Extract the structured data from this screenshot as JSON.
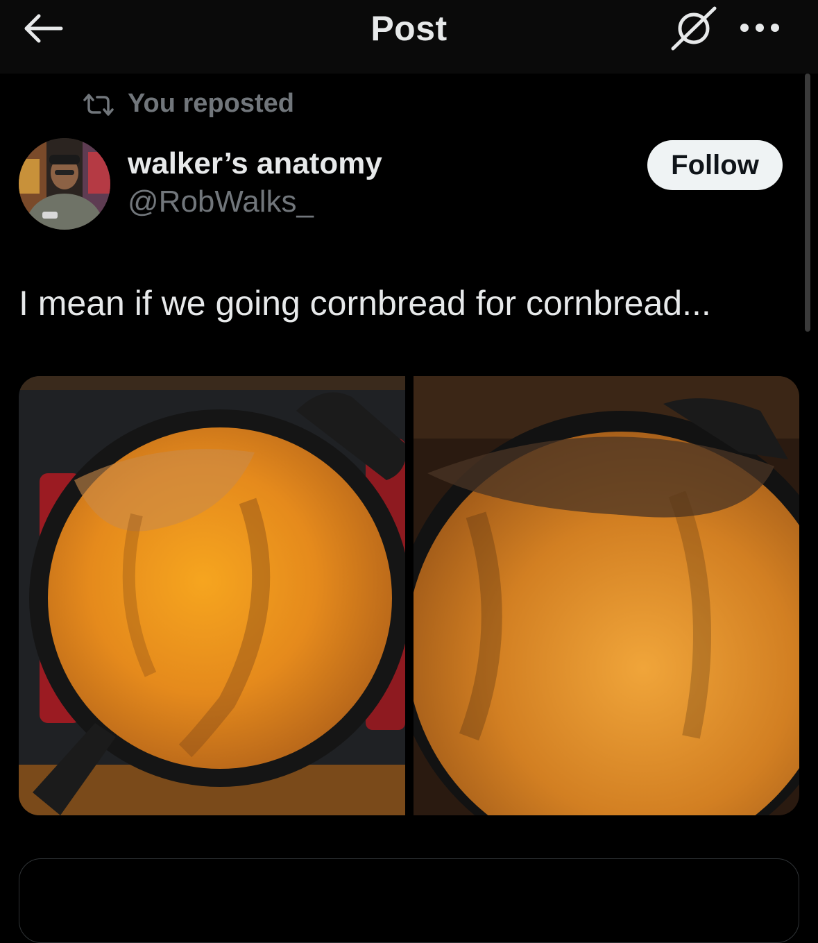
{
  "header": {
    "title": "Post",
    "back_icon": "arrow-left-icon",
    "grok_icon": "grok-icon",
    "more_icon": "more-horizontal-icon"
  },
  "repost": {
    "icon": "repost-icon",
    "label": "You reposted"
  },
  "author": {
    "display_name": "walker’s anatomy",
    "handle": "@RobWalks_",
    "avatar": "avatar-image"
  },
  "follow_button": {
    "label": "Follow"
  },
  "post": {
    "text": "I mean if we going cornbread for cornbread..."
  },
  "media": [
    {
      "name": "cornbread-skillet-photo-1"
    },
    {
      "name": "cornbread-skillet-photo-2"
    }
  ],
  "colors": {
    "background": "#000000",
    "text_primary": "#e7e9ea",
    "text_secondary": "#71767b",
    "follow_bg": "#eff3f4",
    "follow_text": "#0f1419"
  }
}
